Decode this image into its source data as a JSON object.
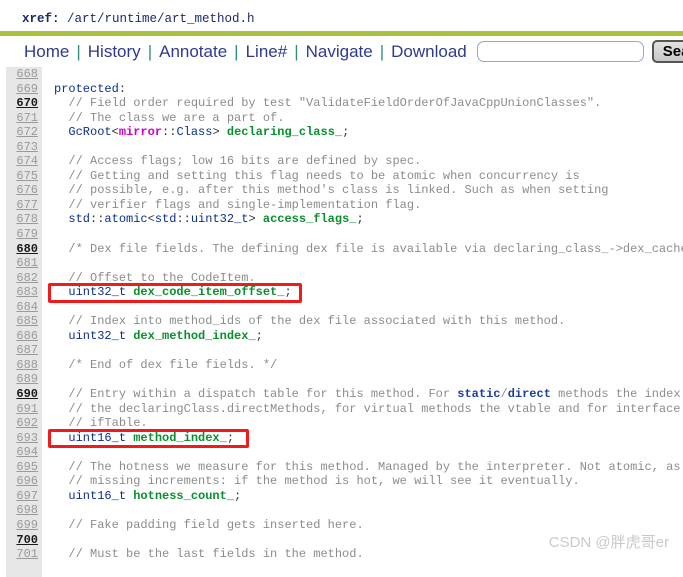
{
  "header": {
    "xref_label": "xref:",
    "xref_path": "/art/runtime/art_method.h",
    "rule_color": "#a9c23f"
  },
  "menubar": {
    "items": [
      {
        "label": "Home"
      },
      {
        "label": "History"
      },
      {
        "label": "Annotate"
      },
      {
        "label": "Line#"
      },
      {
        "label": "Navigate"
      },
      {
        "label": "Download"
      }
    ],
    "separator": "|",
    "search": {
      "value": "",
      "placeholder": ""
    },
    "search_button_label": "Search",
    "link_color": "#2f3a8f",
    "separator_color": "#2f8f7a"
  },
  "code": {
    "first_line": 668,
    "last_line": 701,
    "lines": [
      {
        "n": 668,
        "text": ""
      },
      {
        "n": 669,
        "text": "protected:"
      },
      {
        "n": 670,
        "text": "  // Field order required by test \"ValidateFieldOrderOfJavaCppUnionClasses\"."
      },
      {
        "n": 671,
        "text": "  // The class we are a part of."
      },
      {
        "n": 672,
        "text": "  GcRoot<mirror::Class> declaring_class_;"
      },
      {
        "n": 673,
        "text": ""
      },
      {
        "n": 674,
        "text": "  // Access flags; low 16 bits are defined by spec."
      },
      {
        "n": 675,
        "text": "  // Getting and setting this flag needs to be atomic when concurrency is"
      },
      {
        "n": 676,
        "text": "  // possible, e.g. after this method's class is linked. Such as when setting"
      },
      {
        "n": 677,
        "text": "  // verifier flags and single-implementation flag."
      },
      {
        "n": 678,
        "text": "  std::atomic<std::uint32_t> access_flags_;"
      },
      {
        "n": 679,
        "text": ""
      },
      {
        "n": 680,
        "text": "  /* Dex file fields. The defining dex file is available via declaring_class_->dex_cache_ *"
      },
      {
        "n": 681,
        "text": ""
      },
      {
        "n": 682,
        "text": "  // Offset to the CodeItem."
      },
      {
        "n": 683,
        "text": "  uint32_t dex_code_item_offset_;"
      },
      {
        "n": 684,
        "text": ""
      },
      {
        "n": 685,
        "text": "  // Index into method_ids of the dex file associated with this method."
      },
      {
        "n": 686,
        "text": "  uint32_t dex_method_index_;"
      },
      {
        "n": 687,
        "text": ""
      },
      {
        "n": 688,
        "text": "  /* End of dex file fields. */"
      },
      {
        "n": 689,
        "text": ""
      },
      {
        "n": 690,
        "text": "  // Entry within a dispatch table for this method. For static/direct methods the index is"
      },
      {
        "n": 691,
        "text": "  // the declaringClass.directMethods, for virtual methods the vtable and for interface met"
      },
      {
        "n": 692,
        "text": "  // ifTable."
      },
      {
        "n": 693,
        "text": "  uint16_t method_index_;"
      },
      {
        "n": 694,
        "text": ""
      },
      {
        "n": 695,
        "text": "  // The hotness we measure for this method. Managed by the interpreter. Not atomic, as we"
      },
      {
        "n": 696,
        "text": "  // missing increments: if the method is hot, we will see it eventually."
      },
      {
        "n": 697,
        "text": "  uint16_t hotness_count_;"
      },
      {
        "n": 698,
        "text": ""
      },
      {
        "n": 699,
        "text": "  // Fake padding field gets inserted here."
      },
      {
        "n": 700,
        "text": ""
      },
      {
        "n": 701,
        "text": "  // Must be the last fields in the method."
      }
    ],
    "colors": {
      "comment": "#8c8c8c",
      "type": "#0b2f8f",
      "member": "#0a8f2e",
      "namespace": "#cc00cc",
      "gutter_bg": "#e6e6e6",
      "lineno": "#9a9a9a",
      "lineno_decade": "#1a1a1a"
    }
  },
  "annotations": {
    "highlight_color": "#f01c1c",
    "boxes": [
      {
        "label": "dex_code_item_offset-highlight",
        "line": 683
      },
      {
        "label": "method_index-highlight",
        "line": 693
      }
    ]
  },
  "watermark": {
    "text": "CSDN @胖虎哥er"
  }
}
